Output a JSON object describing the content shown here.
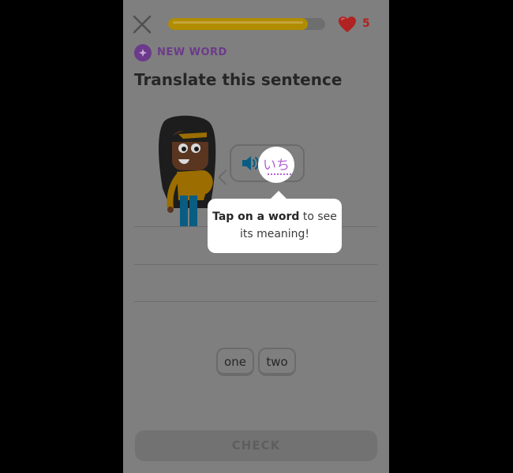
{
  "header": {
    "progress_fraction": 0.89,
    "hearts_count": "5",
    "progress_color": "#b08d00",
    "heart_color": "#b12222"
  },
  "badge": {
    "label": "NEW WORD",
    "color": "#6c3a8a"
  },
  "prompt": {
    "title": "Translate this sentence"
  },
  "speech": {
    "word": "いち",
    "word_color": "#b561d6"
  },
  "tooltip": {
    "bold": "Tap on a word",
    "rest_line1": " to see",
    "line2": "its meaning!"
  },
  "word_bank": [
    {
      "label": "one"
    },
    {
      "label": "two"
    }
  ],
  "footer": {
    "check_label": "CHECK"
  }
}
